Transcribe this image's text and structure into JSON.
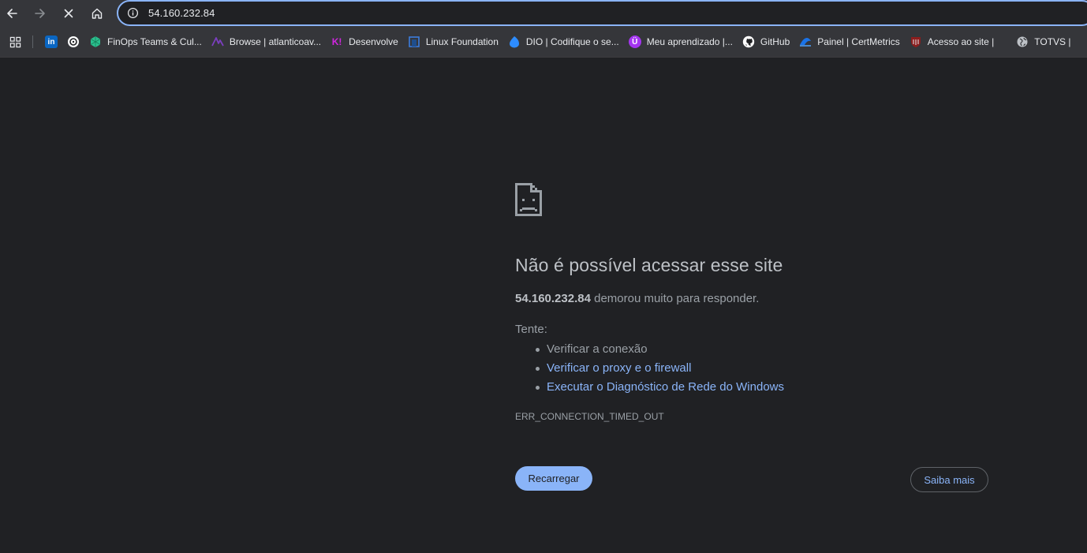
{
  "toolbar": {
    "back_icon": "arrow-left-icon",
    "forward_icon": "arrow-right-icon",
    "stop_icon": "close-icon",
    "home_icon": "home-icon",
    "url": "54.160.232.84"
  },
  "bookmarks": [
    {
      "label": "",
      "icon": "linkedin-icon",
      "color": "#0a66c2"
    },
    {
      "label": "",
      "icon": "chatgpt-icon",
      "color": "#ffffff"
    },
    {
      "label": "FinOps Teams & Cul...",
      "icon": "finops-icon",
      "color": "#2bbf8e"
    },
    {
      "label": "Browse | atlanticoav...",
      "icon": "atlantico-icon",
      "color": "#6b2fa3"
    },
    {
      "label": "Desenvolve",
      "icon": "desenvolve-icon",
      "color": "#c026d3"
    },
    {
      "label": "Linux Foundation",
      "icon": "linux-foundation-icon",
      "color": "#1f4e8c"
    },
    {
      "label": "DIO | Codifique o se...",
      "icon": "dio-icon",
      "color": "#2d8cff"
    },
    {
      "label": "Meu aprendizado |...",
      "icon": "udemy-icon",
      "color": "#a435f0"
    },
    {
      "label": "GitHub",
      "icon": "github-icon",
      "color": "#ffffff"
    },
    {
      "label": "Painel | CertMetrics",
      "icon": "certmetrics-icon",
      "color": "#1a73e8"
    },
    {
      "label": "Acesso ao site |",
      "icon": "shield-icon",
      "color": "#c0392b"
    },
    {
      "label": "TOTVS |",
      "icon": "globe-icon",
      "color": "#bdc1c6"
    }
  ],
  "error": {
    "title": "Não é possível acessar esse site",
    "host": "54.160.232.84",
    "message": " demorou muito para responder.",
    "try_label": "Tente:",
    "suggestions": [
      "Verificar a conexão",
      "Verificar o proxy e o firewall",
      "Executar o Diagnóstico de Rede do Windows"
    ],
    "code": "ERR_CONNECTION_TIMED_OUT",
    "reload_label": "Recarregar",
    "more_label": "Saiba mais"
  }
}
